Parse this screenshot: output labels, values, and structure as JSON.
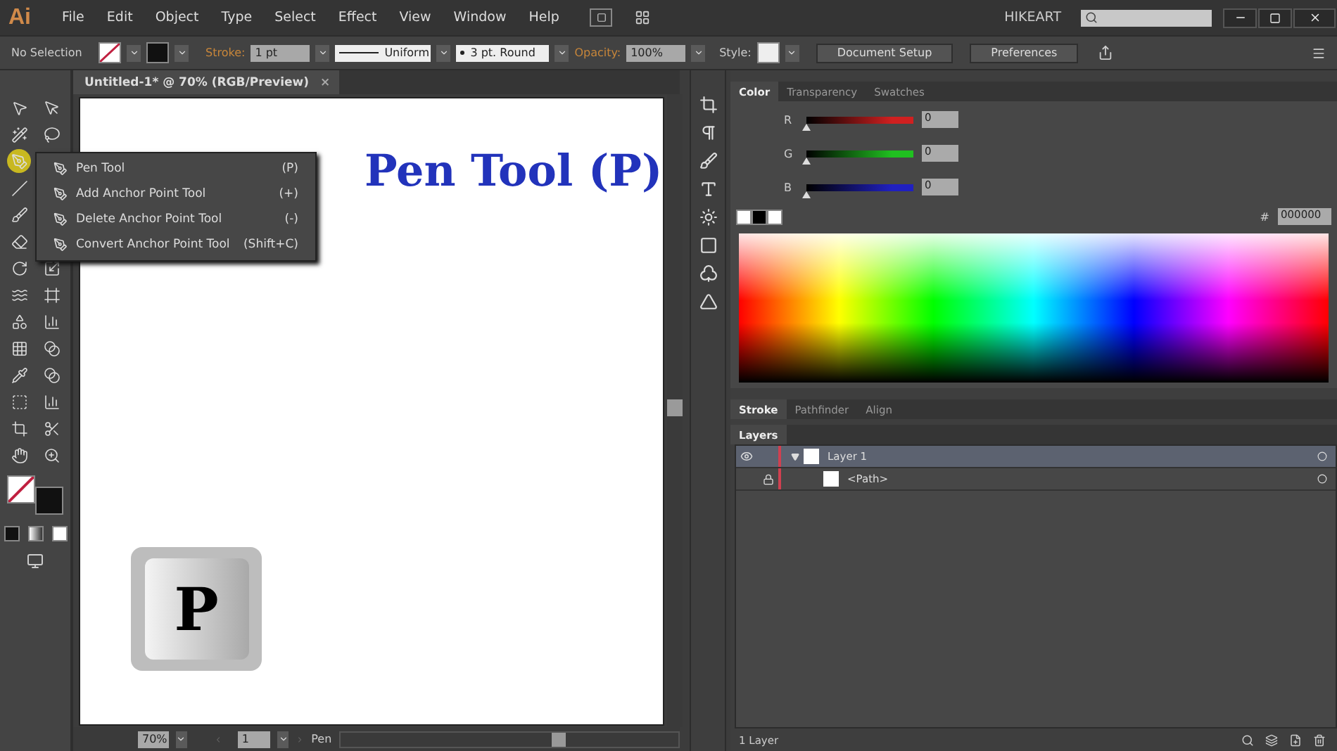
{
  "app": {
    "logo": "Ai",
    "menu": [
      "File",
      "Edit",
      "Object",
      "Type",
      "Select",
      "Effect",
      "View",
      "Window",
      "Help"
    ],
    "workspace": "HIKEART"
  },
  "control_bar": {
    "selection": "No Selection",
    "stroke_label": "Stroke:",
    "stroke_weight": "1 pt",
    "profile": "Uniform",
    "brush": "3 pt. Round",
    "opacity_label": "Opacity:",
    "opacity": "100%",
    "style_label": "Style:",
    "buttons": [
      "Document Setup",
      "Preferences"
    ]
  },
  "document": {
    "tab": "Untitled-1* @ 70% (RGB/Preview)",
    "close": "×",
    "heading": "Pen Tool (P)",
    "key": "P"
  },
  "flyout": [
    {
      "label": "Pen Tool",
      "shortcut": "(P)"
    },
    {
      "label": "Add Anchor Point Tool",
      "shortcut": "(+)"
    },
    {
      "label": "Delete Anchor Point Tool",
      "shortcut": "(-)"
    },
    {
      "label": "Convert Anchor Point Tool",
      "shortcut": "(Shift+C)"
    }
  ],
  "status_bar": {
    "zoom": "70%",
    "artboard": "1",
    "tool": "Pen"
  },
  "color_panel": {
    "tabs": [
      {
        "label": "Color",
        "selected": true
      },
      {
        "label": "Transparency",
        "selected": false
      },
      {
        "label": "Swatches",
        "selected": false
      }
    ],
    "channels": [
      {
        "name": "R",
        "value": "0",
        "level": 0,
        "color": "#d02020"
      },
      {
        "name": "G",
        "value": "0",
        "level": 0,
        "color": "#20c020"
      },
      {
        "name": "B",
        "value": "0",
        "level": 0,
        "color": "#2020c0"
      }
    ],
    "hex_label": "#",
    "hex": "000000"
  },
  "stroke_panel": {
    "tabs": [
      {
        "label": "Stroke",
        "selected": true
      },
      {
        "label": "Pathfinder",
        "selected": false
      },
      {
        "label": "Align",
        "selected": false
      }
    ]
  },
  "layers_panel": {
    "title": "Layers",
    "count": "1 Layer",
    "layers": [
      {
        "name": "Layer 1",
        "visible": true,
        "locked": false,
        "expanded": true,
        "selected": true,
        "children": [
          {
            "name": "<Path>",
            "visible": false,
            "locked": true,
            "selected": false
          }
        ]
      }
    ]
  }
}
